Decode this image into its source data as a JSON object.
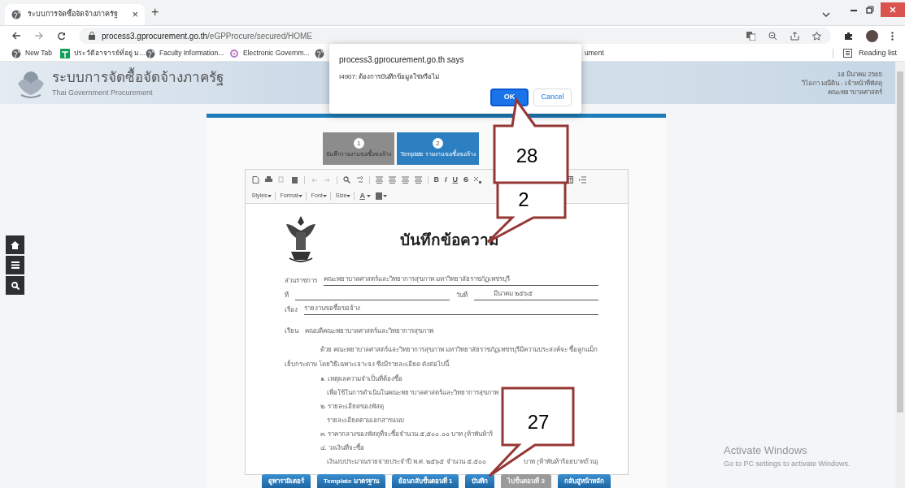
{
  "browser": {
    "tab_title": "ระบบการจัดซื้อจัดจ้างภาครัฐ",
    "tab_close": "×",
    "new_tab": "+",
    "url_host": "process3.gprocurement.go.th",
    "url_path": "/eGPProcure/secured/HOME",
    "bookmarks": [
      {
        "label": "New Tab",
        "kind": "globe"
      },
      {
        "label": "ประวัติอาจารย์ที่อยู่ ม...",
        "kind": "sheet"
      },
      {
        "label": "Faculty Information...",
        "kind": "globe"
      },
      {
        "label": "Electronic Governm...",
        "kind": "logo"
      },
      {
        "label": "ument",
        "kind": "globe"
      }
    ],
    "reading_list": "Reading list"
  },
  "dialog": {
    "title": "process3.gprocurement.go.th says",
    "message": "I4907: ต้องการบันทึกข้อมูลใช่หรือไม่",
    "buttons": [
      {
        "label": "OK",
        "kind": "primary"
      },
      {
        "label": "Cancel",
        "kind": "secondary"
      }
    ]
  },
  "header": {
    "title": "ระบบการจัดซื้อจัดจ้างภาครัฐ",
    "subtitle": "Thai Government Procurement",
    "date": "18 มีนาคม 2565",
    "user": "วิไลภา มณีดิน - เจ้าหน้าที่พัสดุ",
    "department": "คณะพยาบาลศาสตร์"
  },
  "steps": [
    {
      "number": "1",
      "label": "บันทึกรายงานขอซื้อขอจ้าง",
      "selected": false
    },
    {
      "number": "2",
      "label": "Template รายงานขอซื้อขอจ้าง",
      "selected": true
    }
  ],
  "editor": {
    "format_letters": [
      "B",
      "I",
      "U",
      "S"
    ],
    "dropdowns": [
      "Styles",
      "Format",
      "Font",
      "Size"
    ],
    "text_color": "A"
  },
  "document": {
    "heading": "บันทึกข้อความ",
    "office_label": "ส่วนราชการ",
    "office": "คณะพยาบาลศาสตร์และวิทยาการสุขภาพ มหาวิทยาลัยราชภัฏเพชรบุรี",
    "number_label": "ที่",
    "date_label": "วันที่",
    "date": "มีนาคม ๒๕๖๕",
    "subject_label": "เรื่อง",
    "subject": "รายงานขอซื้อขอจ้าง",
    "to_label": "เรียน",
    "to": "คณบดีคณะพยาบาลศาสตร์และวิทยาการสุขภาพ",
    "paragraph": "ด้วย คณะพยาบาลศาสตร์และวิทยาการสุขภาพ มหาวิทยาลัยราชภัฏเพชรบุรีมีความประสงค์จะ ซื้อลูกแม็กเย็บกระดาษ โดยวิธีเฉพาะเจาะจง ซึ่งมีรายละเอียด ดังต่อไปนี้",
    "items": [
      {
        "title": "๑. เหตุผลความจำเป็นที่ต้องซื้อ",
        "detail": "เพื่อใช้ในการดำเนินในคณะพยาบาลศาสตร์และวิทยาการสุขภาพ"
      },
      {
        "title": "๒. รายละเอียดของพัสดุ",
        "detail": "รายละเอียดตามเอกสารแนบ"
      },
      {
        "title": "๓. ราคากลางของพัสดุที่จะซื้อจำนวน ๕,๕๐๐.๐๐ บาท (ห้าพันห้าร้"
      },
      {
        "title": "๔. วงเงินที่จะซื้อ",
        "detail": "เงินงบประมาณรายจ่ายประจำปี พ.ศ. ๒๕๖๕ จำนวน ๕,๕๐๐",
        "detail_end": "บาท (ห้าพันห้าร้อยบาทถ้วน)"
      }
    ]
  },
  "footer_buttons": [
    {
      "label": "ดูพารามิเตอร์",
      "disabled": false
    },
    {
      "label": "Template มาตรฐาน",
      "disabled": false
    },
    {
      "label": "ย้อนกลับขั้นตอนที่ 1",
      "disabled": false
    },
    {
      "label": "บันทึก",
      "disabled": false
    },
    {
      "label": "ไปขั้นตอนที่ 3",
      "disabled": true
    },
    {
      "label": "กลับสู่หน้าหลัก",
      "disabled": false
    }
  ],
  "callouts": [
    {
      "number": "2"
    },
    {
      "number": "28"
    },
    {
      "number": "27"
    }
  ],
  "watermark": {
    "title": "Activate Windows",
    "subtitle": "Go to PC settings to activate Windows."
  }
}
